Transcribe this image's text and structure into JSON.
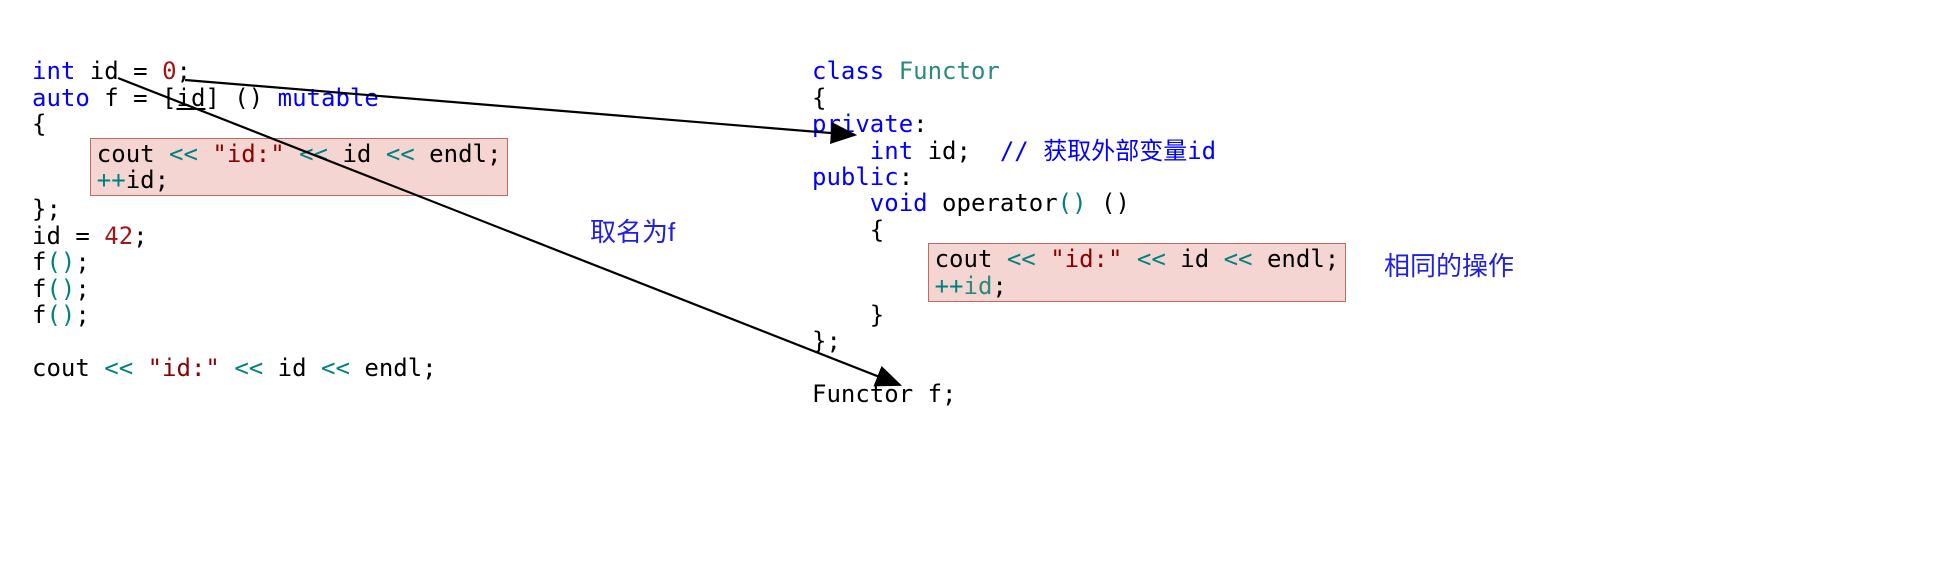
{
  "left": {
    "l1_kw": "int",
    "l1_id": " id = ",
    "l1_num": "0",
    "l1_semi": ";",
    "l2_kw": "auto",
    "l2_txt1": " f = [",
    "l2_id": "id",
    "l2_txt2": "] () ",
    "l2_kw2": "mutable",
    "l3_brace": "{",
    "box_line1_cout": "cout ",
    "box_line1_op1": "<<",
    "box_line1_sp1": " ",
    "box_line1_str": "\"id:\"",
    "box_line1_sp2": " ",
    "box_line1_op2": "<<",
    "box_line1_sp3": " id ",
    "box_line1_op3": "<<",
    "box_line1_sp4": " endl",
    "box_line1_semi": ";",
    "box_line2_op": "++",
    "box_line2_id": "id",
    "box_line2_semi": ";",
    "l6_close": "};",
    "l7_txt": "id = ",
    "l7_num": "42",
    "l7_semi": ";",
    "l8_f": "f",
    "l8_p1": "(",
    "l8_p2": ")",
    "l8_semi": ";",
    "l9_f": "f",
    "l9_p1": "(",
    "l9_p2": ")",
    "l9_semi": ";",
    "l10_f": "f",
    "l10_p1": "(",
    "l10_p2": ")",
    "l10_semi": ";",
    "l12_cout": "cout ",
    "l12_op1": "<<",
    "l12_sp1": " ",
    "l12_str": "\"id:\"",
    "l12_sp2": " ",
    "l12_op2": "<<",
    "l12_sp3": " id ",
    "l12_op3": "<<",
    "l12_sp4": " endl",
    "l12_semi": ";"
  },
  "right": {
    "r1_kw": "class",
    "r1_sp": " ",
    "r1_name": "Functor",
    "r2_brace": "{",
    "r3_kw": "private",
    "r3_colon": ":",
    "r4_indent": "    ",
    "r4_kw": "int",
    "r4_id": " id;  ",
    "r4_comment": "// 获取外部变量id",
    "r5_kw": "public",
    "r5_colon": ":",
    "r6_indent": "    ",
    "r6_kw": "void",
    "r6_txt": " operator",
    "r6_p1": "()",
    "r6_sp": " ",
    "r6_p2": "()",
    "r7_indent": "    ",
    "r7_brace": "{",
    "rbox_line1_cout": "cout ",
    "rbox_line1_op1": "<<",
    "rbox_line1_sp1": " ",
    "rbox_line1_str": "\"id:\"",
    "rbox_line1_sp2": " ",
    "rbox_line1_op2": "<<",
    "rbox_line1_sp3": " id ",
    "rbox_line1_op3": "<<",
    "rbox_line1_sp4": " endl",
    "rbox_line1_semi": ";",
    "rbox_line2_op": "++",
    "rbox_line2_id": "id",
    "rbox_line2_semi": ";",
    "r10_indent": "    ",
    "r10_brace": "}",
    "r11_close": "};",
    "r13_txt": "Functor f;"
  },
  "annotations": {
    "a1": "取名为f",
    "a2": "相同的操作"
  }
}
